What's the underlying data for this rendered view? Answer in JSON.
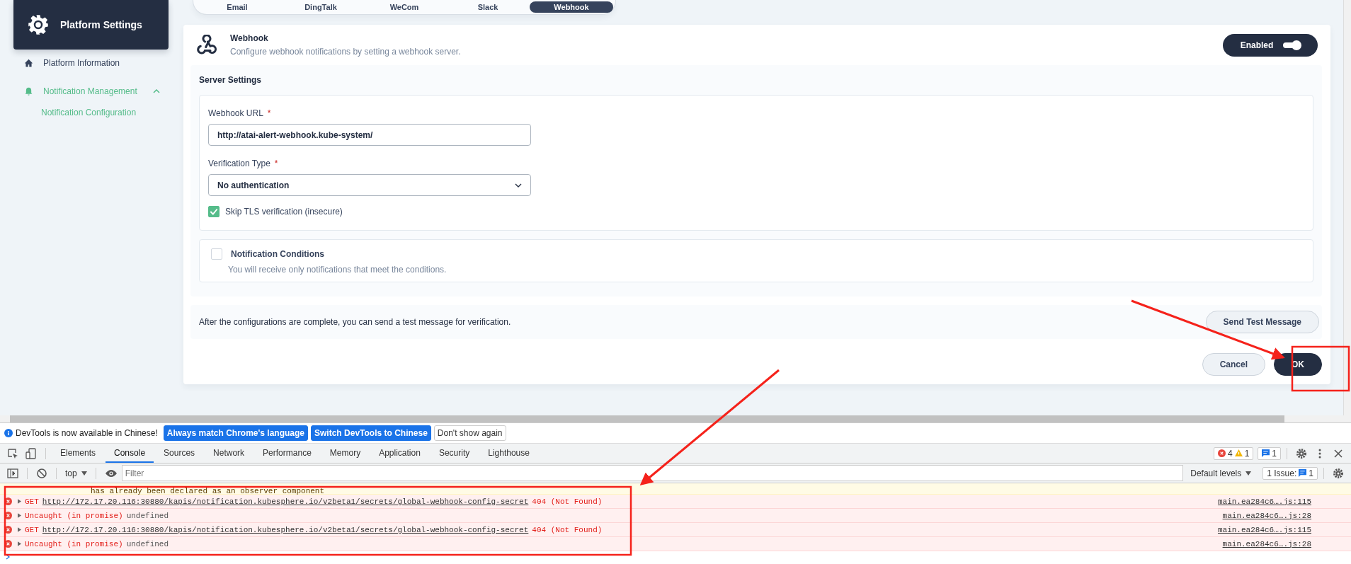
{
  "sidebar": {
    "title": "Platform Settings",
    "items": [
      {
        "kind": "link",
        "label": "Platform Information",
        "selected": false
      },
      {
        "kind": "group",
        "label": "Notification Management",
        "expanded": true,
        "children": [
          {
            "label": "Notification Configuration",
            "selected": true
          }
        ]
      }
    ]
  },
  "tabs": [
    {
      "label": "Email",
      "selected": false
    },
    {
      "label": "DingTalk",
      "selected": false
    },
    {
      "label": "WeCom",
      "selected": false
    },
    {
      "label": "Slack",
      "selected": false
    },
    {
      "label": "Webhook",
      "selected": true
    }
  ],
  "channel": {
    "title": "Webhook",
    "description": "Configure webhook notifications by setting a webhook server.",
    "toggle": {
      "label": "Enabled",
      "on": true
    }
  },
  "server_settings": {
    "title": "Server Settings",
    "fields": [
      {
        "kind": "input",
        "label": "Webhook URL",
        "required_mark": "*",
        "value": "http://atai-alert-webhook.kube-system/"
      },
      {
        "kind": "select",
        "label": "Verification Type",
        "required_mark": "*",
        "value": "No authentication"
      }
    ],
    "skip_tls": {
      "label": "Skip TLS verification (insecure)",
      "checked": true
    }
  },
  "conditions": {
    "title": "Notification Conditions",
    "description": "You will receive only notifications that meet the conditions.",
    "checked": false
  },
  "test": {
    "text": "After the configurations are complete, you can send a test message for verification.",
    "button": "Send Test Message"
  },
  "footer_buttons": [
    {
      "kind": "secondary",
      "label": "Cancel"
    },
    {
      "kind": "primary",
      "label": "OK"
    }
  ],
  "devtools": {
    "banner": {
      "text": "DevTools is now available in Chinese!",
      "buttons": [
        {
          "kind": "primary",
          "label": "Always match Chrome's language"
        },
        {
          "kind": "primary",
          "label": "Switch DevTools to Chinese"
        },
        {
          "kind": "secondary",
          "label": "Don't show again"
        }
      ]
    },
    "tabs": [
      {
        "label": "Elements",
        "selected": false
      },
      {
        "label": "Console",
        "selected": true
      },
      {
        "label": "Sources",
        "selected": false
      },
      {
        "label": "Network",
        "selected": false
      },
      {
        "label": "Performance",
        "selected": false
      },
      {
        "label": "Memory",
        "selected": false
      },
      {
        "label": "Application",
        "selected": false
      },
      {
        "label": "Security",
        "selected": false
      },
      {
        "label": "Lighthouse",
        "selected": false
      }
    ],
    "counts": {
      "errors": "4",
      "warnings": "1",
      "messages": "1"
    },
    "context": "top",
    "filter": {
      "placeholder": "Filter"
    },
    "levels": "Default levels",
    "issues": {
      "label": "1 Issue:",
      "count": "1"
    },
    "partial_line": "has already been declared as an observer component",
    "messages": [
      {
        "kind": "request",
        "method": "GET",
        "url": "http://172.17.20.116:30880/kapis/notification.kubesphere.io/v2beta1/secrets/global-webhook-config-secret",
        "status": "404 (Not Found)",
        "source": "main.ea284c6….js:115"
      },
      {
        "kind": "rejection",
        "text": "Uncaught (in promise)",
        "detail": "undefined",
        "source": "main.ea284c6….js:28"
      },
      {
        "kind": "request",
        "method": "GET",
        "url": "http://172.17.20.116:30880/kapis/notification.kubesphere.io/v2beta1/secrets/global-webhook-config-secret",
        "status": "404 (Not Found)",
        "source": "main.ea284c6….js:115"
      },
      {
        "kind": "rejection",
        "text": "Uncaught (in promise)",
        "detail": "undefined",
        "source": "main.ea284c6….js:28"
      }
    ]
  }
}
